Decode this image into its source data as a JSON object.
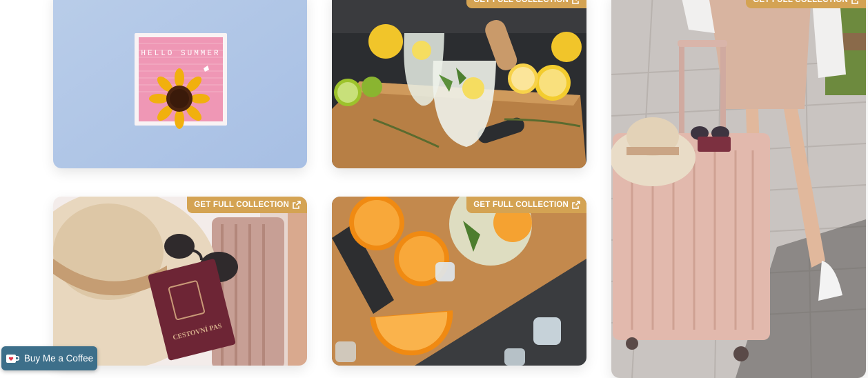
{
  "badge_label": "GET FULL COLLECTION",
  "badge_icon": "external-link-icon",
  "colors": {
    "badge": "#d4a353",
    "coffee_button": "#3d6f8a",
    "background": "#ffffff"
  },
  "photos": [
    {
      "subject": "hello-summer-letter-board",
      "letter_board_text": "HELLO SUMMER",
      "has_badge": false
    },
    {
      "subject": "lemonade-on-cutting-board",
      "has_badge": true
    },
    {
      "subject": "woman-with-pink-suitcase",
      "has_badge": true
    },
    {
      "subject": "straw-hat-passport-suitcase",
      "passport_text": "CESTOVNÍ PAS",
      "has_badge": true
    },
    {
      "subject": "oranges-on-cutting-board",
      "has_badge": true
    }
  ],
  "coffee_button": {
    "label": "Buy Me a Coffee",
    "icon": "coffee-cup-icon"
  }
}
